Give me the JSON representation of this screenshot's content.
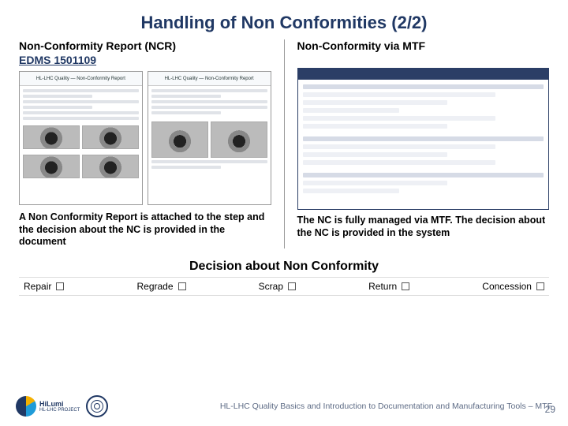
{
  "title": "Handling of Non Conformities (2/2)",
  "left": {
    "heading": "Non-Conformity Report (NCR)",
    "edms_link": "EDMS 1501109",
    "thumb_title": "HL-LHC Quality — Non-Conformity Report",
    "caption": "A Non Conformity Report is attached to the step and the decision about the NC is provided in the document"
  },
  "right": {
    "heading": "Non-Conformity via MTF",
    "caption": "The NC is fully managed via MTF. The decision about the NC is provided in the system"
  },
  "decision": {
    "title": "Decision about Non Conformity",
    "options": [
      "Repair",
      "Regrade",
      "Scrap",
      "Return",
      "Concession"
    ]
  },
  "footer": {
    "logo1_text": "HiLumi",
    "logo1_sub": "HL-LHC PROJECT",
    "text": "HL-LHC Quality Basics and Introduction to Documentation and Manufacturing Tools – MTF",
    "page": "29"
  }
}
